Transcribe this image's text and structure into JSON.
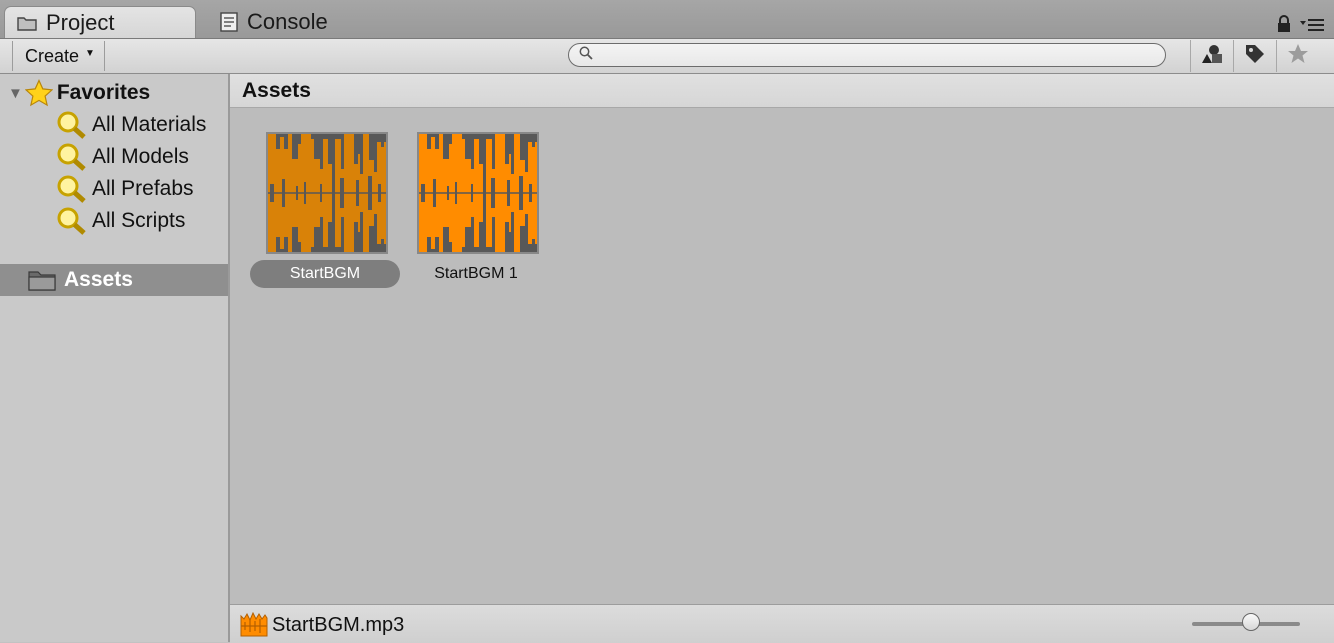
{
  "tabs": [
    {
      "label": "Project",
      "icon": "folder-icon",
      "active": true
    },
    {
      "label": "Console",
      "icon": "console-icon",
      "active": false
    }
  ],
  "toolbar": {
    "create_label": "Create",
    "search_placeholder": ""
  },
  "sidebar": {
    "favorites_label": "Favorites",
    "favorites": [
      {
        "label": "All Materials"
      },
      {
        "label": "All Models"
      },
      {
        "label": "All Prefabs"
      },
      {
        "label": "All Scripts"
      }
    ],
    "assets_label": "Assets"
  },
  "main": {
    "breadcrumb": "Assets",
    "items": [
      {
        "label": "StartBGM",
        "selected": true,
        "color": "#d98208"
      },
      {
        "label": "StartBGM 1",
        "selected": false,
        "color": "#ff8c00"
      }
    ]
  },
  "status": {
    "filename": "StartBGM.mp3",
    "zoom_fraction": 0.55
  },
  "colors": {
    "accent_orange": "#ff8c00",
    "selected_orange": "#d98208",
    "waveform": "#585858",
    "selection_gray": "#8f8f8f"
  }
}
